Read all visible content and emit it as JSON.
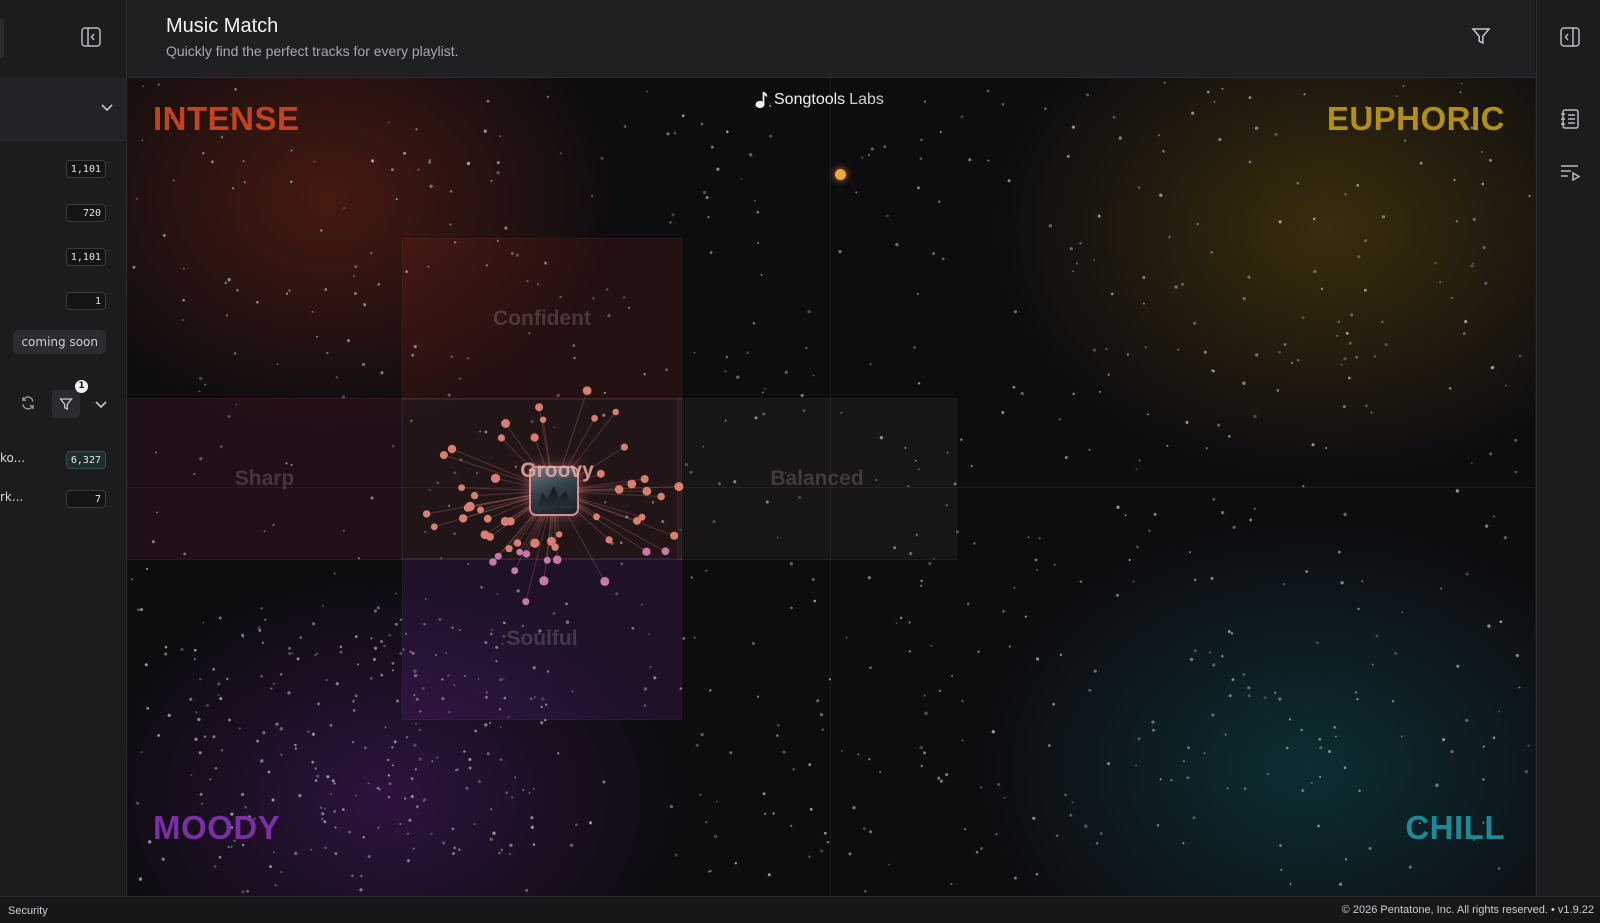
{
  "header": {
    "title": "Music Match",
    "subtitle": "Quickly find the perfect tracks for every playlist."
  },
  "sidebar": {
    "stats": [
      "1,101",
      "720",
      "1,101",
      "1"
    ],
    "coming_soon": "coming soon",
    "filter_badge": "1",
    "rows": [
      {
        "label": "ko...",
        "value": "6,327"
      },
      {
        "label": "rk...",
        "value": "7"
      }
    ]
  },
  "map": {
    "brand": "Songtools",
    "brand_suffix": "Labs",
    "corners": {
      "top_left": "INTENSE",
      "top_right": "EUPHORIC",
      "bottom_left": "MOODY",
      "bottom_right": "CHILL"
    },
    "zones": {
      "confident": "Confident",
      "sharp": "Sharp",
      "groovy": "Groovy",
      "balanced": "Balanced",
      "soulful": "Soulful"
    },
    "colors": {
      "intense": "#c2441c",
      "euphoric": "#b58f12",
      "moody": "#7b2fa6",
      "chill": "#1a8a96",
      "highlight": "#f0a93a",
      "node": "#d97f70"
    }
  },
  "footer": {
    "left": "Security",
    "right": "© 2026 Pentatone, Inc. All rights reserved. • v1.9.22"
  }
}
